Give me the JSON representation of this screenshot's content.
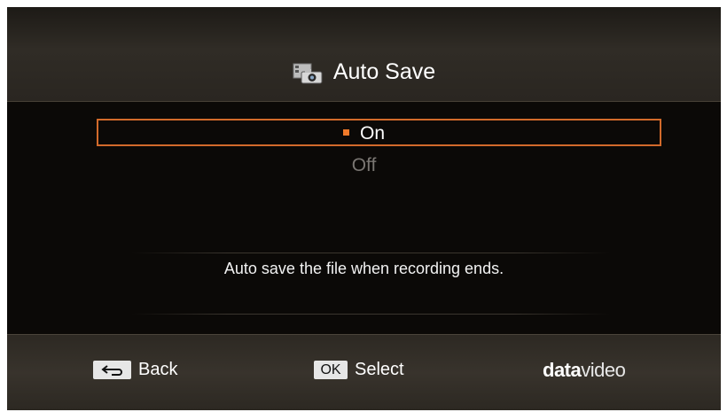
{
  "header": {
    "title": "Auto Save",
    "icon": "camera-icon"
  },
  "options": [
    {
      "label": "On",
      "selected": true
    },
    {
      "label": "Off",
      "selected": false
    }
  ],
  "description": "Auto save the file when recording ends.",
  "footer": {
    "back_label": "Back",
    "back_key_icon": "return-arrow-icon",
    "ok_key": "OK",
    "select_label": "Select",
    "brand_bold": "data",
    "brand_light": "video"
  },
  "colors": {
    "accent": "#d26a2b",
    "bullet": "#f07a2a",
    "background": "#0b0907"
  }
}
